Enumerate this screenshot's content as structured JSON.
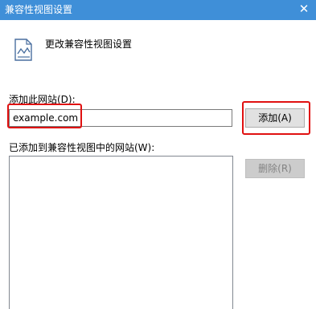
{
  "window": {
    "title": "兼容性视图设置",
    "close_glyph": "✕"
  },
  "header": {
    "icon": "compat-view-icon",
    "text": "更改兼容性视图设置"
  },
  "add_section": {
    "label": "添加此网站(D):",
    "input_value": "example.com",
    "add_button": "添加(A)"
  },
  "list_section": {
    "label": "已添加到兼容性视图中的网站(W):",
    "items": [],
    "remove_button": "删除(R)"
  },
  "colors": {
    "titlebar": "#3f8fd8",
    "highlight": "#e01010"
  }
}
